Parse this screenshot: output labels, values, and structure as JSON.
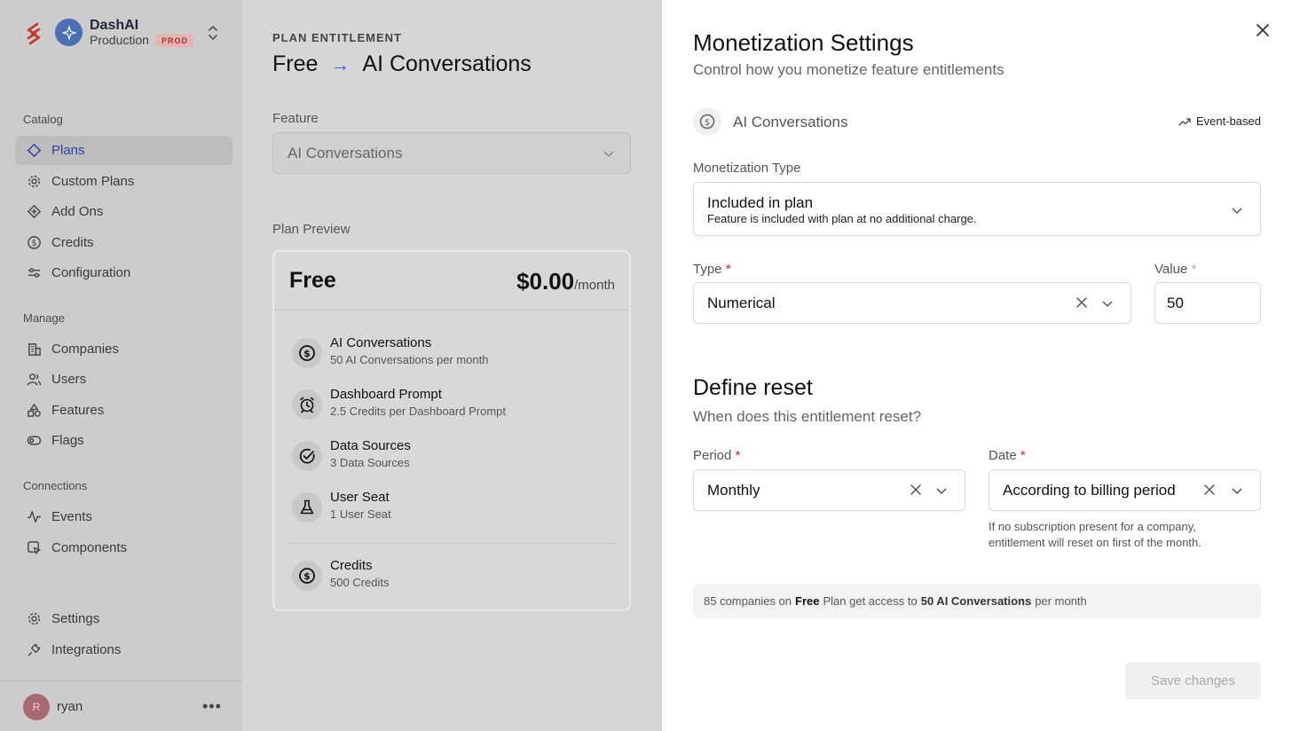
{
  "sidebar": {
    "org_name": "DashAI",
    "environment": "Production",
    "env_badge": "PROD",
    "sections": {
      "catalog": "Catalog",
      "manage": "Manage",
      "connections": "Connections"
    },
    "items": {
      "plans": "Plans",
      "custom_plans": "Custom Plans",
      "add_ons": "Add Ons",
      "credits": "Credits",
      "configuration": "Configuration",
      "companies": "Companies",
      "users": "Users",
      "features": "Features",
      "flags": "Flags",
      "events": "Events",
      "components": "Components",
      "settings": "Settings",
      "integrations": "Integrations"
    },
    "user": {
      "initial": "R",
      "name": "ryan"
    }
  },
  "entitlement": {
    "label": "PLAN ENTITLEMENT",
    "plan": "Free",
    "feature": "AI Conversations",
    "feature_label": "Feature",
    "feature_value": "AI Conversations",
    "preview_label": "Plan Preview"
  },
  "preview": {
    "plan_name": "Free",
    "price": "$0.00",
    "period": "/month",
    "items": [
      {
        "title": "AI Conversations",
        "sub": "50 AI Conversations per month",
        "icon": "dollar-circle-icon"
      },
      {
        "title": "Dashboard Prompt",
        "sub": "2.5 Credits per Dashboard Prompt",
        "icon": "alarm-clock-icon"
      },
      {
        "title": "Data Sources",
        "sub": "3 Data Sources",
        "icon": "check-circle-icon"
      },
      {
        "title": "User Seat",
        "sub": "1 User Seat",
        "icon": "flask-icon"
      }
    ],
    "credits": {
      "title": "Credits",
      "sub": "500 Credits",
      "icon": "dollar-circle-icon"
    }
  },
  "drawer": {
    "title": "Monetization Settings",
    "subtitle": "Control how you monetize feature entitlements",
    "feature_name": "AI Conversations",
    "feature_kind": "Event-based",
    "monetization_label": "Monetization Type",
    "monetization_value": "Included in plan",
    "monetization_desc": "Feature is included with plan at no additional charge.",
    "type_label": "Type",
    "type_value": "Numerical",
    "value_label": "Value",
    "value_value": "50",
    "reset_title": "Define reset",
    "reset_sub": "When does this entitlement reset?",
    "period_label": "Period",
    "period_value": "Monthly",
    "date_label": "Date",
    "date_value": "According to billing period",
    "date_hint": "If no subscription present for a company, entitlement will reset on first of the month.",
    "info": {
      "pre": "85 companies on",
      "plan": "Free",
      "mid": "Plan get access to",
      "amount": "50 AI Conversations",
      "post": "per month"
    },
    "save_label": "Save changes",
    "required_mark": "*"
  },
  "colors": {
    "accent": "#2d3fa8",
    "required": "#d22222"
  }
}
